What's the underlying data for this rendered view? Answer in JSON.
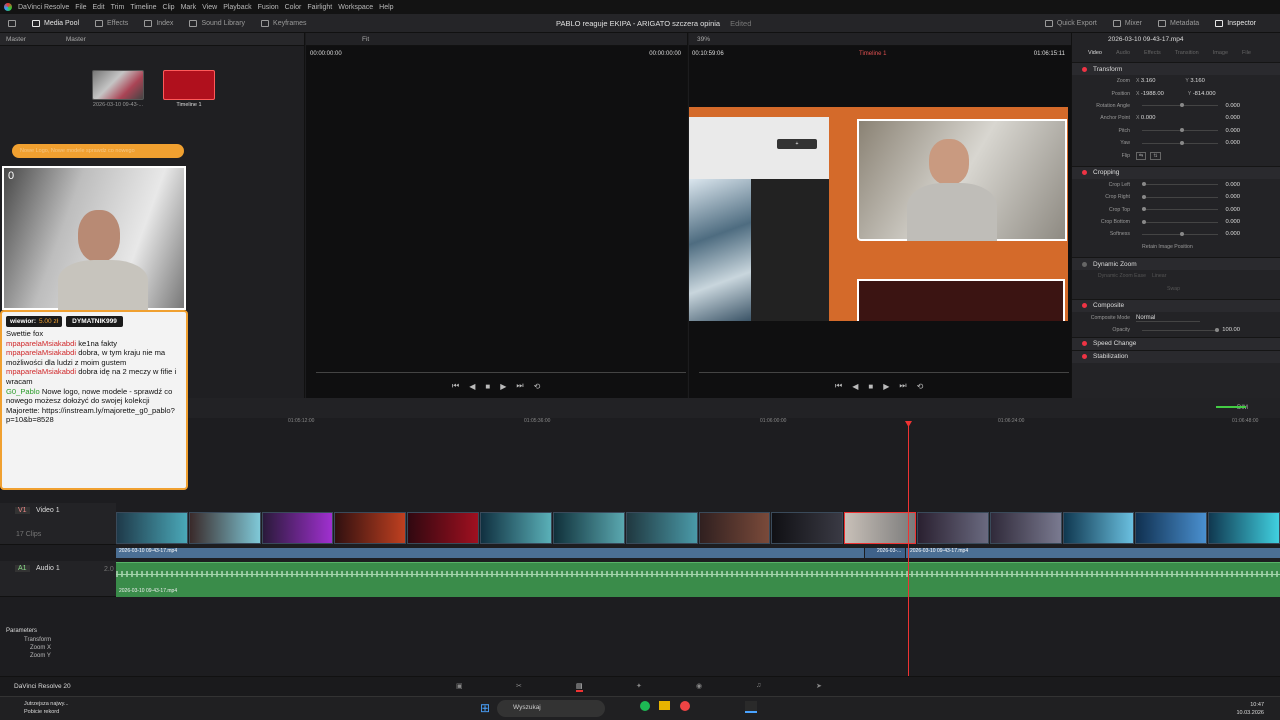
{
  "menubar": {
    "app": "DaVinci Resolve",
    "items": [
      "File",
      "Edit",
      "Trim",
      "Timeline",
      "Clip",
      "Mark",
      "View",
      "Playback",
      "Fusion",
      "Color",
      "Fairlight",
      "Workspace",
      "Help"
    ]
  },
  "toolbar": {
    "left": [
      "Media Pool",
      "Effects",
      "Index",
      "Sound Library",
      "Keyframes"
    ],
    "right": [
      "Quick Export",
      "Mixer",
      "Metadata",
      "Inspector"
    ]
  },
  "project": {
    "title": "PABLO reaguje EKIPA - ARIGATO szczera opinia",
    "status": "Edited"
  },
  "mediapool": {
    "bins": [
      "Master",
      "Master"
    ],
    "clips": [
      {
        "name": "2026-03-10 09-43-..."
      },
      {
        "name": "Timeline 1"
      }
    ]
  },
  "source_viewer": {
    "fit": "Fit",
    "tc_in": "00:00:00:00",
    "tc_out": "00:00:00:00"
  },
  "timeline_viewer": {
    "zoom": "39%",
    "duration": "00:10:59:06",
    "timeline": "Timeline 1",
    "tc": "01:06:15:11"
  },
  "inspector": {
    "file": "2026-03-10 09-43-17.mp4",
    "tabs": [
      "Video",
      "Audio",
      "Effects",
      "Transition",
      "Image",
      "File"
    ],
    "transform": {
      "title": "Transform",
      "zoom_x": "3.160",
      "zoom_y": "3.160",
      "pos_x": "-1988.00",
      "pos_y": "-814.000",
      "rows": [
        {
          "k": "Rotation Angle",
          "v": "0.000",
          "p": 50
        },
        {
          "k": "Anchor Point",
          "v": "0.000",
          "p": 50
        },
        {
          "k": "Pitch",
          "v": "0.000",
          "p": 50
        },
        {
          "k": "Yaw",
          "v": "0.000",
          "p": 50
        }
      ],
      "labels": {
        "zoom": "Zoom",
        "position": "Position",
        "anchor_x": "0.000",
        "flip": "Flip"
      }
    },
    "cropping": {
      "title": "Cropping",
      "rows": [
        {
          "k": "Crop Left",
          "v": "0.000",
          "p": 0
        },
        {
          "k": "Crop Right",
          "v": "0.000",
          "p": 0
        },
        {
          "k": "Crop Top",
          "v": "0.000",
          "p": 0
        },
        {
          "k": "Crop Bottom",
          "v": "0.000",
          "p": 0
        },
        {
          "k": "Softness",
          "v": "0.000",
          "p": 50
        }
      ],
      "retain": "Retain Image Position"
    },
    "dynamic_zoom": {
      "title": "Dynamic Zoom",
      "ease": "Dynamic Zoom Ease",
      "ease_val": "Linear",
      "swap": "Swap"
    },
    "composite": {
      "title": "Composite",
      "mode_label": "Composite Mode",
      "mode": "Normal",
      "opacity_label": "Opacity",
      "opacity": "100.00"
    },
    "speed": "Speed Change",
    "stab": "Stabilization"
  },
  "timeline": {
    "ruler": [
      "01:05:12:00",
      "01:05:36:00",
      "01:06:00:00",
      "01:06:24:00",
      "01:06:48:00"
    ],
    "v1": {
      "id": "V1",
      "name": "Video 1",
      "clips": "17 Clips"
    },
    "a1": {
      "id": "A1",
      "name": "Audio 1",
      "level": "2.0"
    },
    "clip_label": "2026-03-10 09-43-17.mp4",
    "clip_label2": "2026-03-...",
    "clip_label3": "2026-03-10 09-43-17.mp4",
    "audio_label": "2026-03-10 09-43-17.mp4",
    "dim": "DIM"
  },
  "params": {
    "title": "Parameters",
    "rows": [
      "Transform",
      "Zoom X",
      "Zoom Y"
    ]
  },
  "chat": {
    "bar": "Nowe Logo, Nowe modele sprawdz co nowego",
    "counter": "0",
    "donor1": "wiewior:",
    "donor1_amt": "5.00 zł",
    "donor2": "DYMATNIK999",
    "lines": [
      {
        "name": "",
        "text": "Swettie fox"
      },
      {
        "name": "mpaparelaMsiakabdi",
        "text": "ke1na fakty"
      },
      {
        "name": "mpaparelaMsiakabdi",
        "text": "dobra, w tym kraju nie ma możliwości dla ludzi z moim gustem"
      },
      {
        "name": "mpaparelaMsiakabdi",
        "text": "dobra idę na 2 meczy w fifie i wracam"
      },
      {
        "name": "G0_Pablo",
        "text": "Nowe logo, nowe modele - sprawdź co nowego możesz dołożyć do swojej kolekcji Majorette: https://instream.ly/majorette_g0_pablo?p=10&b=8528"
      }
    ]
  },
  "pagenav": {
    "app": "DaVinci Resolve 20"
  },
  "taskbar": {
    "weather1": "Jutrzejsza najwy...",
    "weather2": "Pobicie rekord",
    "search": "Wyszukaj",
    "time": "10:47",
    "date": "10.03.2026"
  }
}
